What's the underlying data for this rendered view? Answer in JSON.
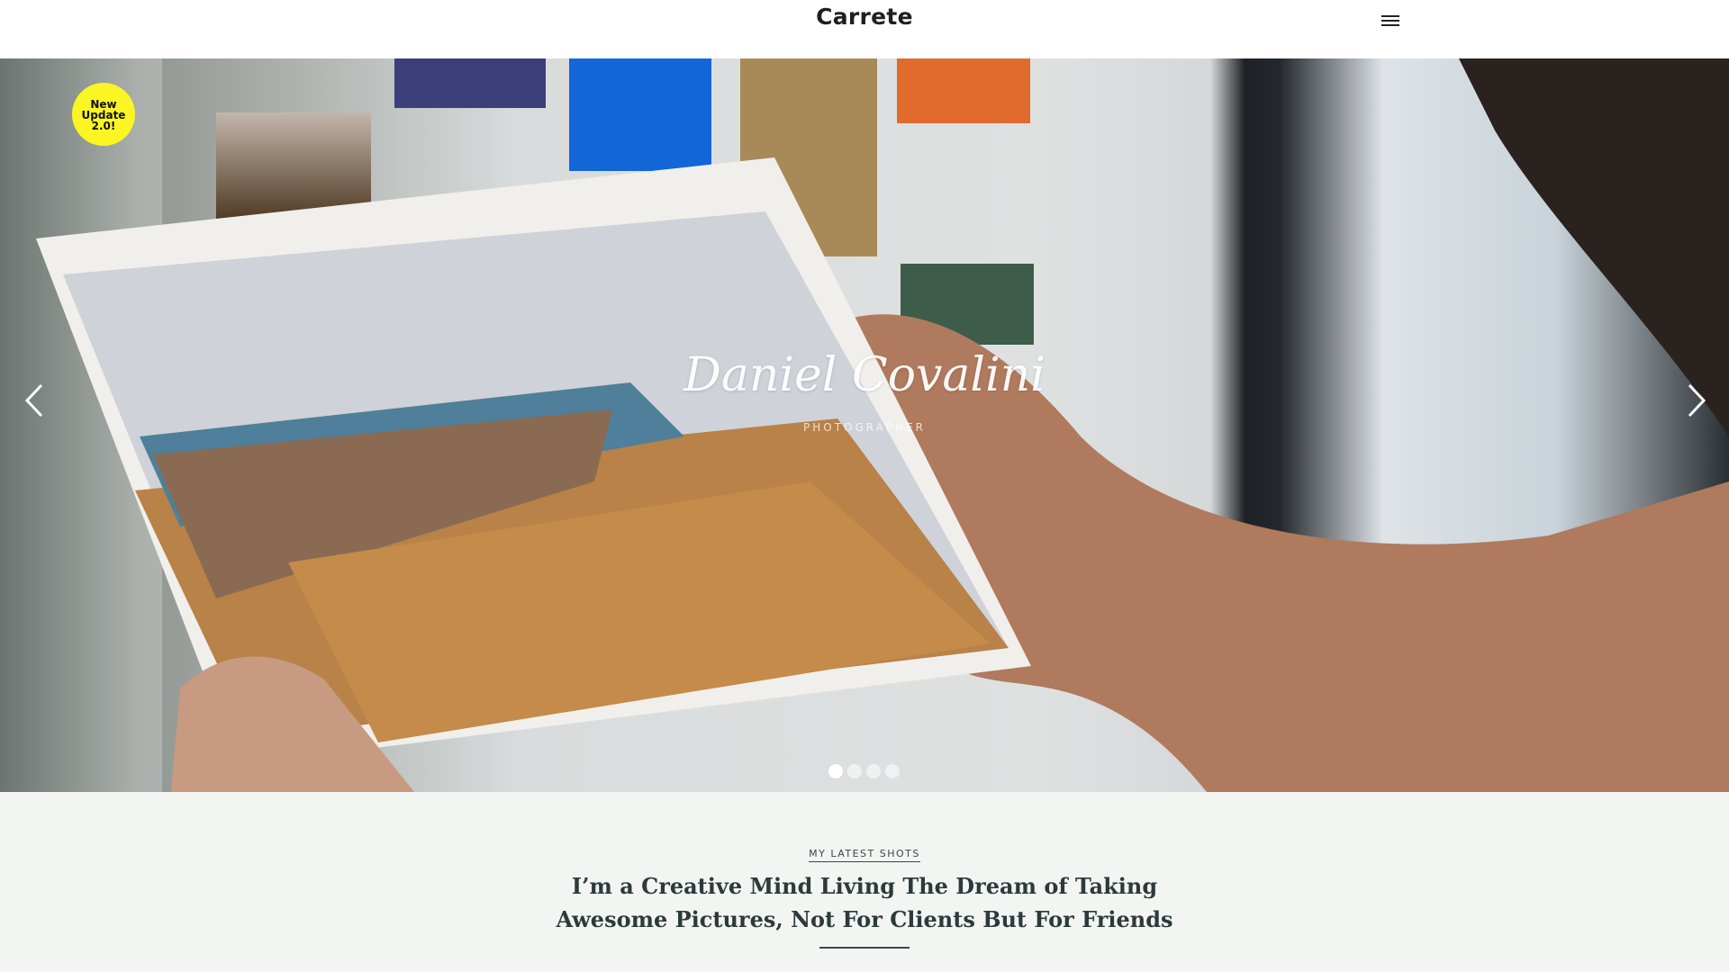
{
  "header": {
    "logo": "Carrete",
    "menu_icon": "hamburger-menu-icon"
  },
  "hero": {
    "badge": {
      "line1": "New",
      "line2": "Update",
      "line3": "2.0!"
    },
    "title": "Daniel Covalini",
    "subtitle": "PHOTOGRAPHER",
    "prev_icon": "chevron-left-icon",
    "next_icon": "chevron-right-icon",
    "slides_total": 4,
    "active_slide": 1
  },
  "intro": {
    "kicker": "MY LATEST SHOTS",
    "heading": "I’m a Creative Mind Living The Dream of Taking Awesome Pictures, Not For Clients But For Friends"
  },
  "colors": {
    "badge": "#fbf524",
    "section_bg": "#f3f5f3",
    "text_dark": "#2d3a3c"
  }
}
